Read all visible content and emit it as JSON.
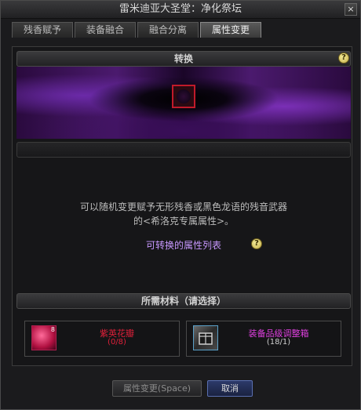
{
  "window": {
    "title": "雷米迪亚大圣堂：净化祭坛",
    "close_label": "×"
  },
  "tabs": [
    {
      "label": "残香赋予",
      "active": false
    },
    {
      "label": "装备融合",
      "active": false
    },
    {
      "label": "融合分离",
      "active": false
    },
    {
      "label": "属性变更",
      "active": true
    }
  ],
  "convert": {
    "header": "转换",
    "help": "?"
  },
  "description": {
    "line1": "可以随机变更赋予无形残香或黑色龙语的残音武器",
    "line2": "的<希洛克专属属性>。"
  },
  "attribute_list": {
    "label": "可转换的属性列表",
    "help": "?"
  },
  "materials": {
    "header": "所需材料（请选择）",
    "items": [
      {
        "name": "紫英花瓣",
        "count": "(0/8)",
        "badge": "8",
        "color": "#e0203a"
      },
      {
        "name": "装备品级调整箱",
        "count": "(18/1)",
        "color": "#e040e0"
      }
    ]
  },
  "buttons": {
    "change": "属性变更(Space)",
    "cancel": "取消"
  },
  "colors": {
    "accent_purple": "#c898ff",
    "danger_red": "#e0203a",
    "magenta": "#e040e0"
  }
}
